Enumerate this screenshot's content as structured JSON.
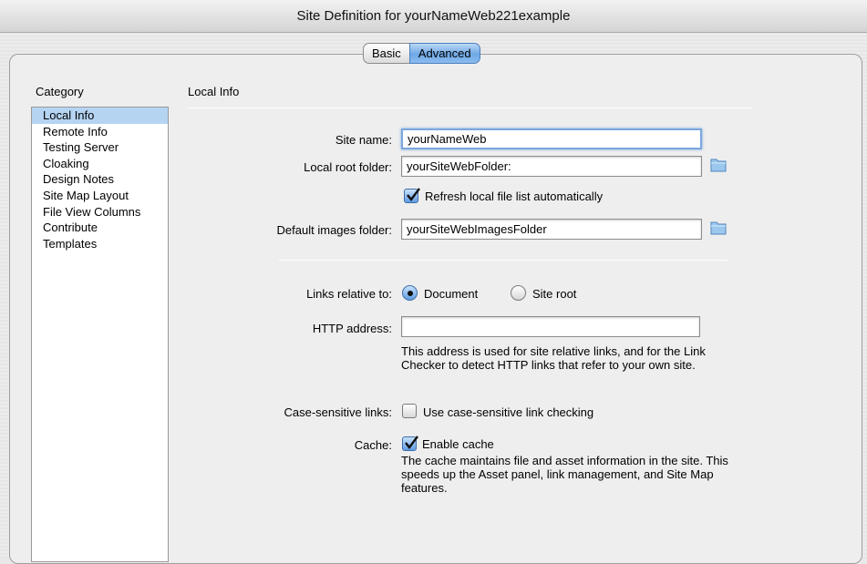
{
  "window": {
    "title": "Site Definition for yourNameWeb221example"
  },
  "tabs": [
    {
      "label": "Basic",
      "active": false
    },
    {
      "label": "Advanced",
      "active": true
    }
  ],
  "category": {
    "heading": "Category",
    "items": [
      {
        "label": "Local Info",
        "selected": true
      },
      {
        "label": "Remote Info"
      },
      {
        "label": "Testing Server"
      },
      {
        "label": "Cloaking"
      },
      {
        "label": "Design Notes"
      },
      {
        "label": "Site Map Layout"
      },
      {
        "label": "File View Columns"
      },
      {
        "label": "Contribute"
      },
      {
        "label": "Templates"
      }
    ]
  },
  "local_info": {
    "section_title": "Local Info",
    "site_name": {
      "label": "Site name:",
      "value": "yourNameWeb"
    },
    "local_root": {
      "label": "Local root folder:",
      "value": "yourSiteWebFolder:"
    },
    "refresh": {
      "label": "Refresh local file list automatically",
      "checked": true
    },
    "images_folder": {
      "label": "Default images folder:",
      "value": "yourSiteWebImagesFolder"
    },
    "links_relative": {
      "label": "Links relative to:",
      "options": [
        {
          "label": "Document",
          "selected": true
        },
        {
          "label": "Site root",
          "selected": false
        }
      ]
    },
    "http_address": {
      "label": "HTTP address:",
      "value": "",
      "help": "This address is used for site relative links, and for the Link Checker to detect HTTP links that refer to your own site."
    },
    "case_sensitive": {
      "label": "Case-sensitive links:",
      "option": "Use case-sensitive link checking",
      "checked": false
    },
    "cache": {
      "label": "Cache:",
      "option": "Enable cache",
      "checked": true,
      "help": "The cache maintains file and asset information in the site.  This speeds up the Asset panel, link management, and Site Map features."
    }
  },
  "icons": {
    "folder": "folder-icon",
    "checkmark": "checkmark-icon"
  },
  "colors": {
    "selection": "#b5d4f2",
    "accent": "#5f9ce3"
  }
}
